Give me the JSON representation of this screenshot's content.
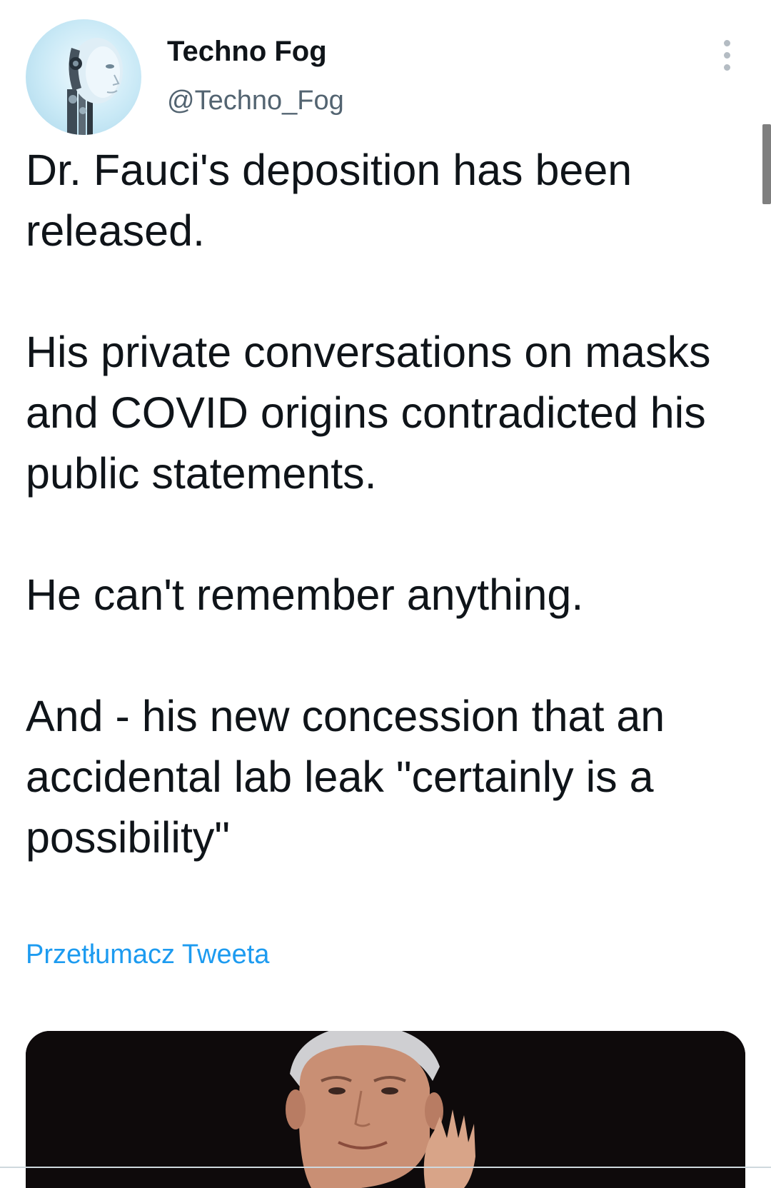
{
  "author": {
    "display_name": "Techno Fog",
    "handle": "@Techno_Fog"
  },
  "tweet": {
    "paragraphs": [
      "Dr. Fauci's deposition has been released.",
      "His private conversations on masks and COVID origins contradicted his public statements.",
      "He can't remember anything.",
      "And - his new concession that an accidental lab leak \"certainly is a possibility\""
    ]
  },
  "translate_link": "Przetłumacz Tweeta",
  "icons": {
    "more": "more-vertical-icon"
  },
  "colors": {
    "text": "#0f1419",
    "secondary_text": "#536471",
    "link": "#1d9bf0",
    "media_background": "#0e0a0b"
  }
}
